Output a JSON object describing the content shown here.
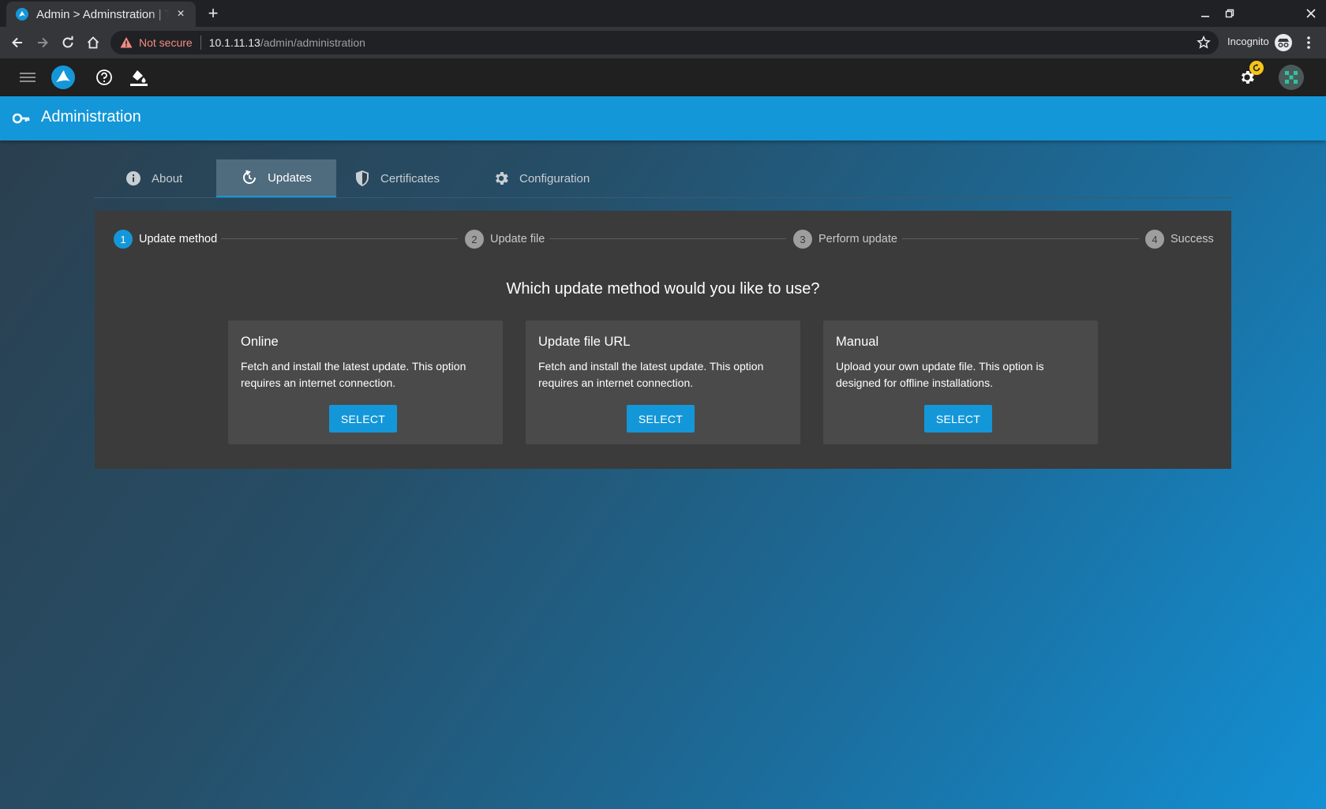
{
  "browser": {
    "tab_title": "Admin > Adminstration | T",
    "tab_close": "×",
    "new_tab": "+",
    "not_secure": "Not secure",
    "url_host": "10.1.11.13",
    "url_path": "/admin/administration",
    "incognito": "Incognito"
  },
  "app": {
    "page_title": "Administration",
    "tabs": [
      {
        "label": "About",
        "icon": "info-icon"
      },
      {
        "label": "Updates",
        "icon": "history-icon",
        "active": true
      },
      {
        "label": "Certificates",
        "icon": "shield-icon"
      },
      {
        "label": "Configuration",
        "icon": "gear-icon"
      }
    ],
    "stepper": [
      {
        "num": "1",
        "label": "Update method",
        "active": true
      },
      {
        "num": "2",
        "label": "Update file"
      },
      {
        "num": "3",
        "label": "Perform update"
      },
      {
        "num": "4",
        "label": "Success"
      }
    ],
    "question": "Which update method would you like to use?",
    "cards": [
      {
        "title": "Online",
        "desc": "Fetch and install the latest update. This option requires an internet connection.",
        "button": "SELECT"
      },
      {
        "title": "Update file URL",
        "desc": "Fetch and install the latest update. This option requires an internet connection.",
        "button": "SELECT"
      },
      {
        "title": "Manual",
        "desc": "Upload your own update file. This option is designed for offline installations.",
        "button": "SELECT"
      }
    ]
  },
  "colors": {
    "accent": "#1497d8",
    "header_bg": "#202020",
    "panel_bg": "#3b3b3b",
    "card_bg": "#4a4a4a",
    "badge": "#f5c518",
    "warning": "#f28b82"
  }
}
